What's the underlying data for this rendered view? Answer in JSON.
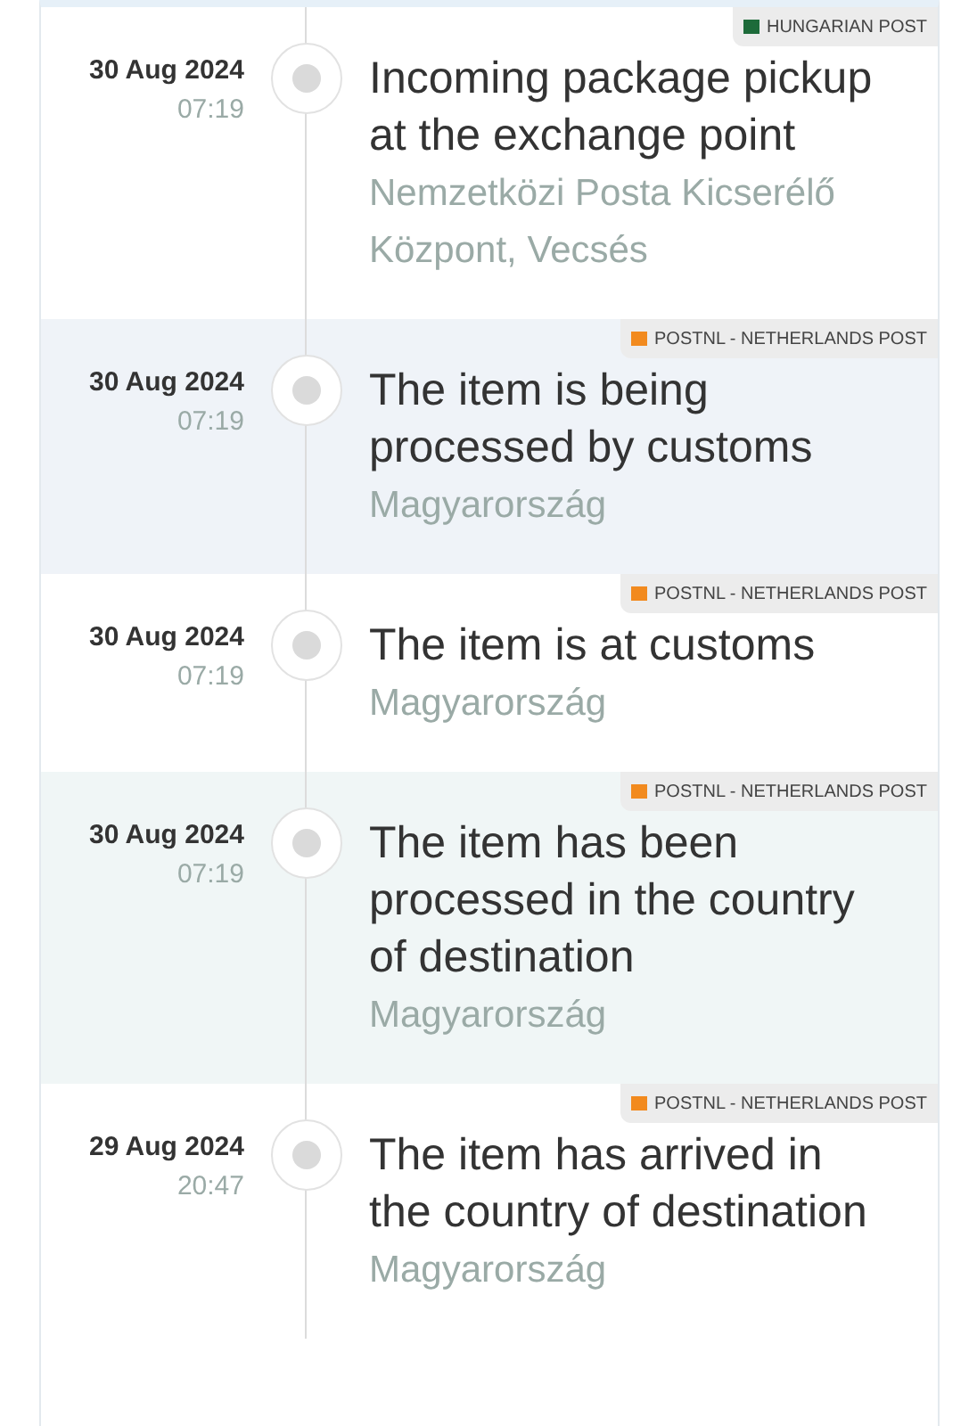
{
  "events": [
    {
      "date": "30 Aug 2024",
      "time": "07:19",
      "title": "Incoming package pickup at the exchange point",
      "location": "Nemzetközi Posta Kicserélő Központ, Vecsés",
      "carrier": {
        "name": "HUNGARIAN POST",
        "color": "#1d6b3a"
      },
      "color": "#ffffff"
    },
    {
      "date": "30 Aug 2024",
      "time": "07:19",
      "title": "The item is being processed by customs",
      "location": "Magyarország",
      "carrier": {
        "name": "POSTNL - NETHERLANDS POST",
        "color": "#f28a1e"
      },
      "color": "#eff3f8"
    },
    {
      "date": "30 Aug 2024",
      "time": "07:19",
      "title": "The item is at customs",
      "location": "Magyarország",
      "carrier": {
        "name": "POSTNL - NETHERLANDS POST",
        "color": "#f28a1e"
      },
      "color": "#ffffff"
    },
    {
      "date": "30 Aug 2024",
      "time": "07:19",
      "title": "The item has been processed in the country of destination",
      "location": "Magyarország",
      "carrier": {
        "name": "POSTNL - NETHERLANDS POST",
        "color": "#f28a1e"
      },
      "color": "#f0f6f6"
    },
    {
      "date": "29 Aug 2024",
      "time": "20:47",
      "title": "The item has arrived in the country of destination",
      "location": "Magyarország",
      "carrier": {
        "name": "POSTNL - NETHERLANDS POST",
        "color": "#f28a1e"
      },
      "color": "#ffffff"
    }
  ]
}
